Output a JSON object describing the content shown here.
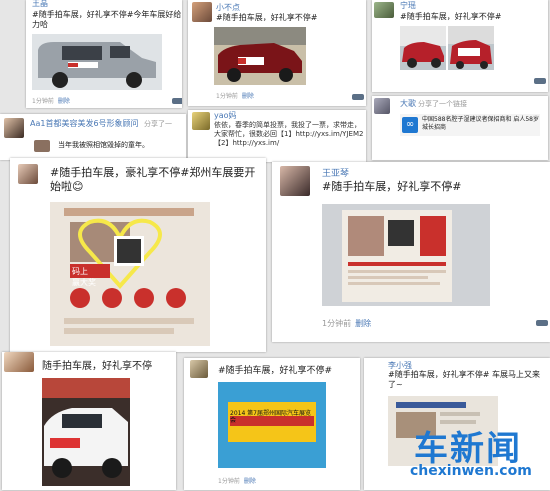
{
  "posts": [
    {
      "name": "王晶",
      "text": "#随手拍车展，好礼享不停#今年车展好给力哈",
      "time": "1分钟前",
      "del": "删除"
    },
    {
      "name": "小不点",
      "text": "#随手拍车展，好礼享不停#",
      "time": "1分钟前",
      "del": "删除"
    },
    {
      "name": "宁瑶",
      "text": "#随手拍车展，好礼享不停#",
      "time": "1分钟前",
      "del": "删除"
    },
    {
      "name": "Aa1首都美容美发6号形象顾问",
      "extra": "分享了一",
      "text": "当年我被照相馆毁掉的童年。"
    },
    {
      "name": "yao妈",
      "text": "依依，春季的简单投票，我投了一票，求带走，大家帮忙，很数必回【1】http://yxs.im/YJEM2【2】http://yxs.im/"
    },
    {
      "name": "大歌",
      "extra": "分享了一个链接",
      "link": "中国588名腔子湿建议者保招商和 启人58岁城长招商"
    },
    {
      "name": "",
      "text": "#随手拍车展，豪礼享不停#郑州车展要开始啦😊"
    },
    {
      "name": "王亚琴",
      "text": "#随手拍车展，好礼享不停#",
      "time": "1分钟前",
      "del": "删除"
    },
    {
      "name": "",
      "text": "随手拍车展，好礼享不停"
    },
    {
      "name": "",
      "text": "#随手拍车展，好礼享不停#",
      "time": "1分钟前",
      "del": "删除"
    },
    {
      "name": "李小强",
      "text": "#随手拍车展，好礼享不停# 车展马上又来了~"
    }
  ],
  "poster_labels": {
    "qr_caption": "码上\n赢大奖",
    "banner": "2014 第7届郑州国际汽车展览会"
  },
  "watermark": {
    "big": "车新闻",
    "small": "chexinwen.com"
  },
  "colors": {
    "link": "#4a78b5",
    "brand": "#1f78d1",
    "red": "#c9302c"
  }
}
